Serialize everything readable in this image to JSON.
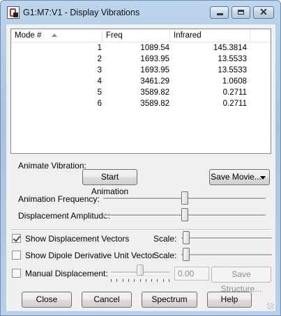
{
  "window": {
    "title": "G1:M7:V1 - Display Vibrations",
    "close_glyph": "✕"
  },
  "table": {
    "columns": [
      "Mode #",
      "Freq",
      "Infrared"
    ],
    "rows": [
      {
        "mode": "1",
        "freq": "1089.54",
        "ir": "145.3814"
      },
      {
        "mode": "2",
        "freq": "1693.95",
        "ir": "13.5533"
      },
      {
        "mode": "3",
        "freq": "1693.95",
        "ir": "13.5533"
      },
      {
        "mode": "4",
        "freq": "3461.29",
        "ir": "1.0608"
      },
      {
        "mode": "5",
        "freq": "3589.82",
        "ir": "0.2711"
      },
      {
        "mode": "6",
        "freq": "3589.82",
        "ir": "0.2711"
      }
    ]
  },
  "animate": {
    "label": "Animate Vibration:",
    "start_label": "Start Animation",
    "save_movie_label": "Save Movie...",
    "frequency_label": "Animation Frequency:",
    "frequency_level": 0.5,
    "amplitude_label": "Displacement Amplitude:",
    "amplitude_level": 0.5
  },
  "options": {
    "show_vectors_label": "Show Displacement Vectors",
    "show_vectors_checked": true,
    "show_dipole_label": "Show Dipole Derivative Unit Vector",
    "show_dipole_checked": false,
    "scale_label": "Scale:",
    "vectors_scale_level": 0.02,
    "dipole_scale_level": 0.02,
    "manual_label": "Manual Displacement:",
    "manual_checked": false,
    "manual_value": "0.00",
    "save_structure_label": "Save Structure..."
  },
  "buttons": {
    "close": "Close",
    "cancel": "Cancel",
    "spectrum": "Spectrum",
    "help": "Help"
  }
}
